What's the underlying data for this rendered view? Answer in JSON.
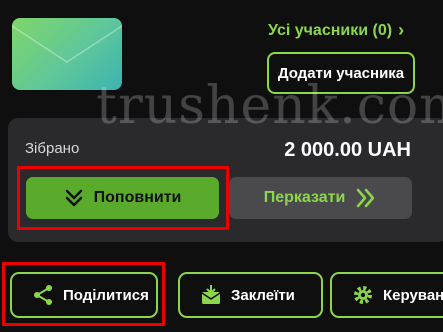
{
  "header": {
    "members_link": "Усі учасники (0)",
    "add_member_button": "Додати учасника"
  },
  "fund": {
    "collected_label": "Зібрано",
    "amount": "2 000.00 UAH",
    "topup_button": "Поповнити",
    "transfer_button": "Перказати"
  },
  "actions": {
    "share": "Поділитися",
    "paste": "Заклеїти",
    "manage": "Керуванн"
  },
  "watermark": "trushenk.com",
  "colors": {
    "accent": "#8cd64c",
    "primary_button": "#5aab2c",
    "card": "#2a2a2c",
    "highlight": "#e00000"
  },
  "icons": {
    "thumbnail": "envelope-icon",
    "members_link": "chevron-right-icon",
    "topup": "double-chevron-down-icon",
    "transfer": "double-chevron-right-icon",
    "share": "share-icon",
    "paste": "envelope-download-icon",
    "manage": "gear-icon"
  }
}
